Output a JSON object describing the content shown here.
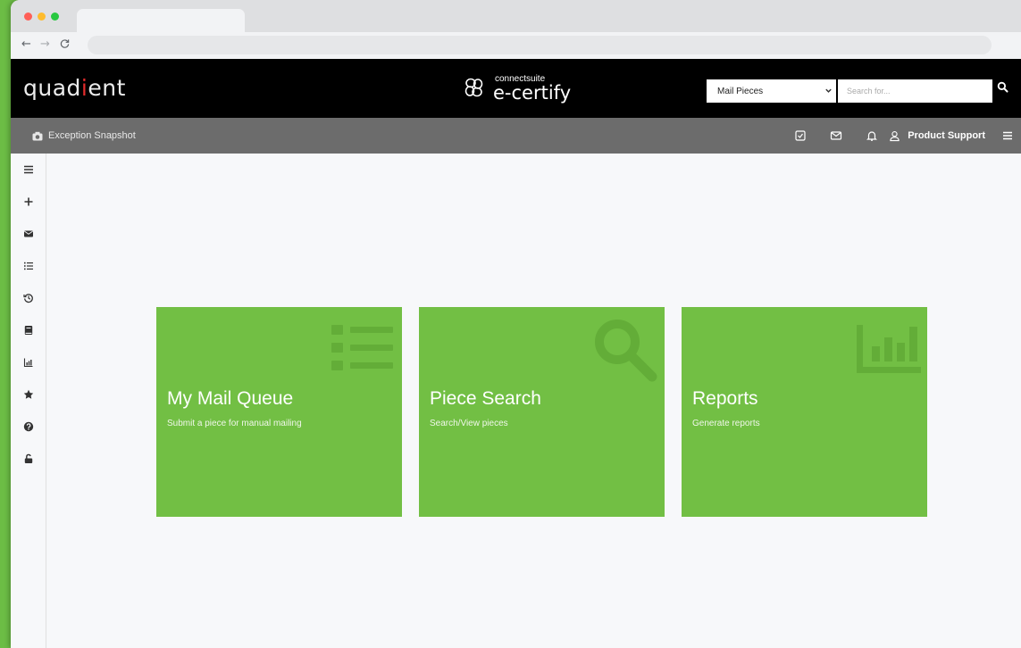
{
  "browser": {
    "traffic_colors": [
      "#ff5f57",
      "#febc2e",
      "#28c840"
    ],
    "nav_back": "←",
    "nav_forward": "→",
    "nav_reload": "C"
  },
  "header": {
    "logo_pre": "quad",
    "logo_accent": "i",
    "logo_post": "ent",
    "brand_small": "connectsuite",
    "brand_name": "e-certify",
    "search_select_value": "Mail Pieces",
    "search_placeholder": "Search for..."
  },
  "subheader": {
    "snapshot_label": "Exception Snapshot",
    "user_name": "Product Support"
  },
  "sidebar": {
    "items": [
      "menu-icon",
      "plus-icon",
      "envelope-icon",
      "list-icon",
      "history-icon",
      "book-icon",
      "chart-icon",
      "star-icon",
      "help-icon",
      "unlock-icon"
    ]
  },
  "tiles": [
    {
      "title": "My Mail Queue",
      "subtitle": "Submit a piece for manual mailing",
      "icon": "list-icon"
    },
    {
      "title": "Piece Search",
      "subtitle": "Search/View pieces",
      "icon": "search-icon"
    },
    {
      "title": "Reports",
      "subtitle": "Generate reports",
      "icon": "bar-chart-icon"
    }
  ],
  "colors": {
    "tile_green": "#72bf44",
    "header_black": "#000000",
    "subheader_gray": "#6c6c6c",
    "accent_red": "#e32b2b"
  }
}
